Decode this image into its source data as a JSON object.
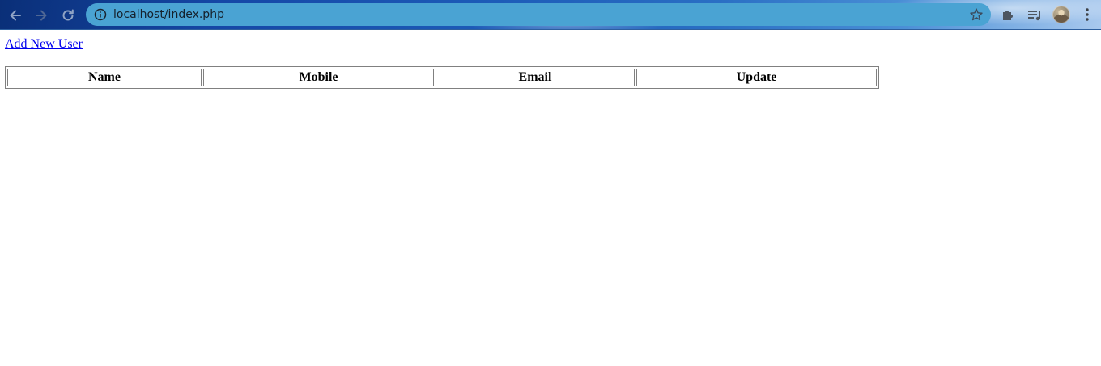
{
  "browser": {
    "url": "localhost/index.php",
    "icons": {
      "back": "back-arrow-icon",
      "forward": "forward-arrow-icon",
      "reload": "reload-icon",
      "site_info": "info-icon",
      "bookmark": "star-icon",
      "extensions": "puzzle-icon",
      "media": "media-queue-icon",
      "profile": "avatar",
      "menu": "kebab-menu-icon"
    }
  },
  "page": {
    "add_link_label": "Add New User",
    "table": {
      "headers": [
        "Name",
        "Mobile",
        "Email",
        "Update"
      ],
      "rows": []
    }
  },
  "colors": {
    "link": "#0000ee",
    "table_border": "#808080",
    "omnibox": "#4aa3d3"
  }
}
